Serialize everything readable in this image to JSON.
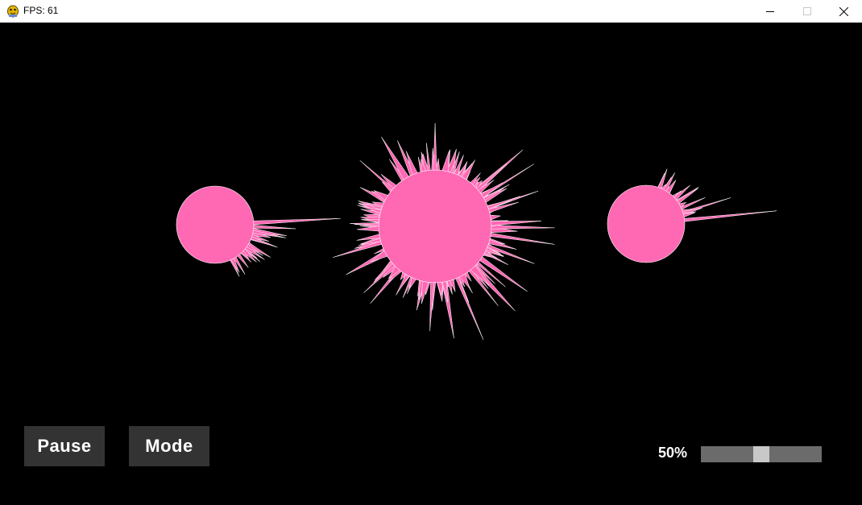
{
  "window": {
    "title": "FPS: 61",
    "controls": [
      "minimize",
      "maximize",
      "close"
    ]
  },
  "visualization": {
    "color": "#ff69b4",
    "blob_count": 3
  },
  "controls": {
    "pause_label": "Pause",
    "mode_label": "Mode"
  },
  "volume": {
    "label": "50%",
    "value": 0.5
  },
  "colors": {
    "background": "#000000",
    "button_bg": "#333333",
    "slider_track": "#6b6b6b",
    "slider_handle": "#c8c8c8",
    "blob": "#ff69b4"
  }
}
